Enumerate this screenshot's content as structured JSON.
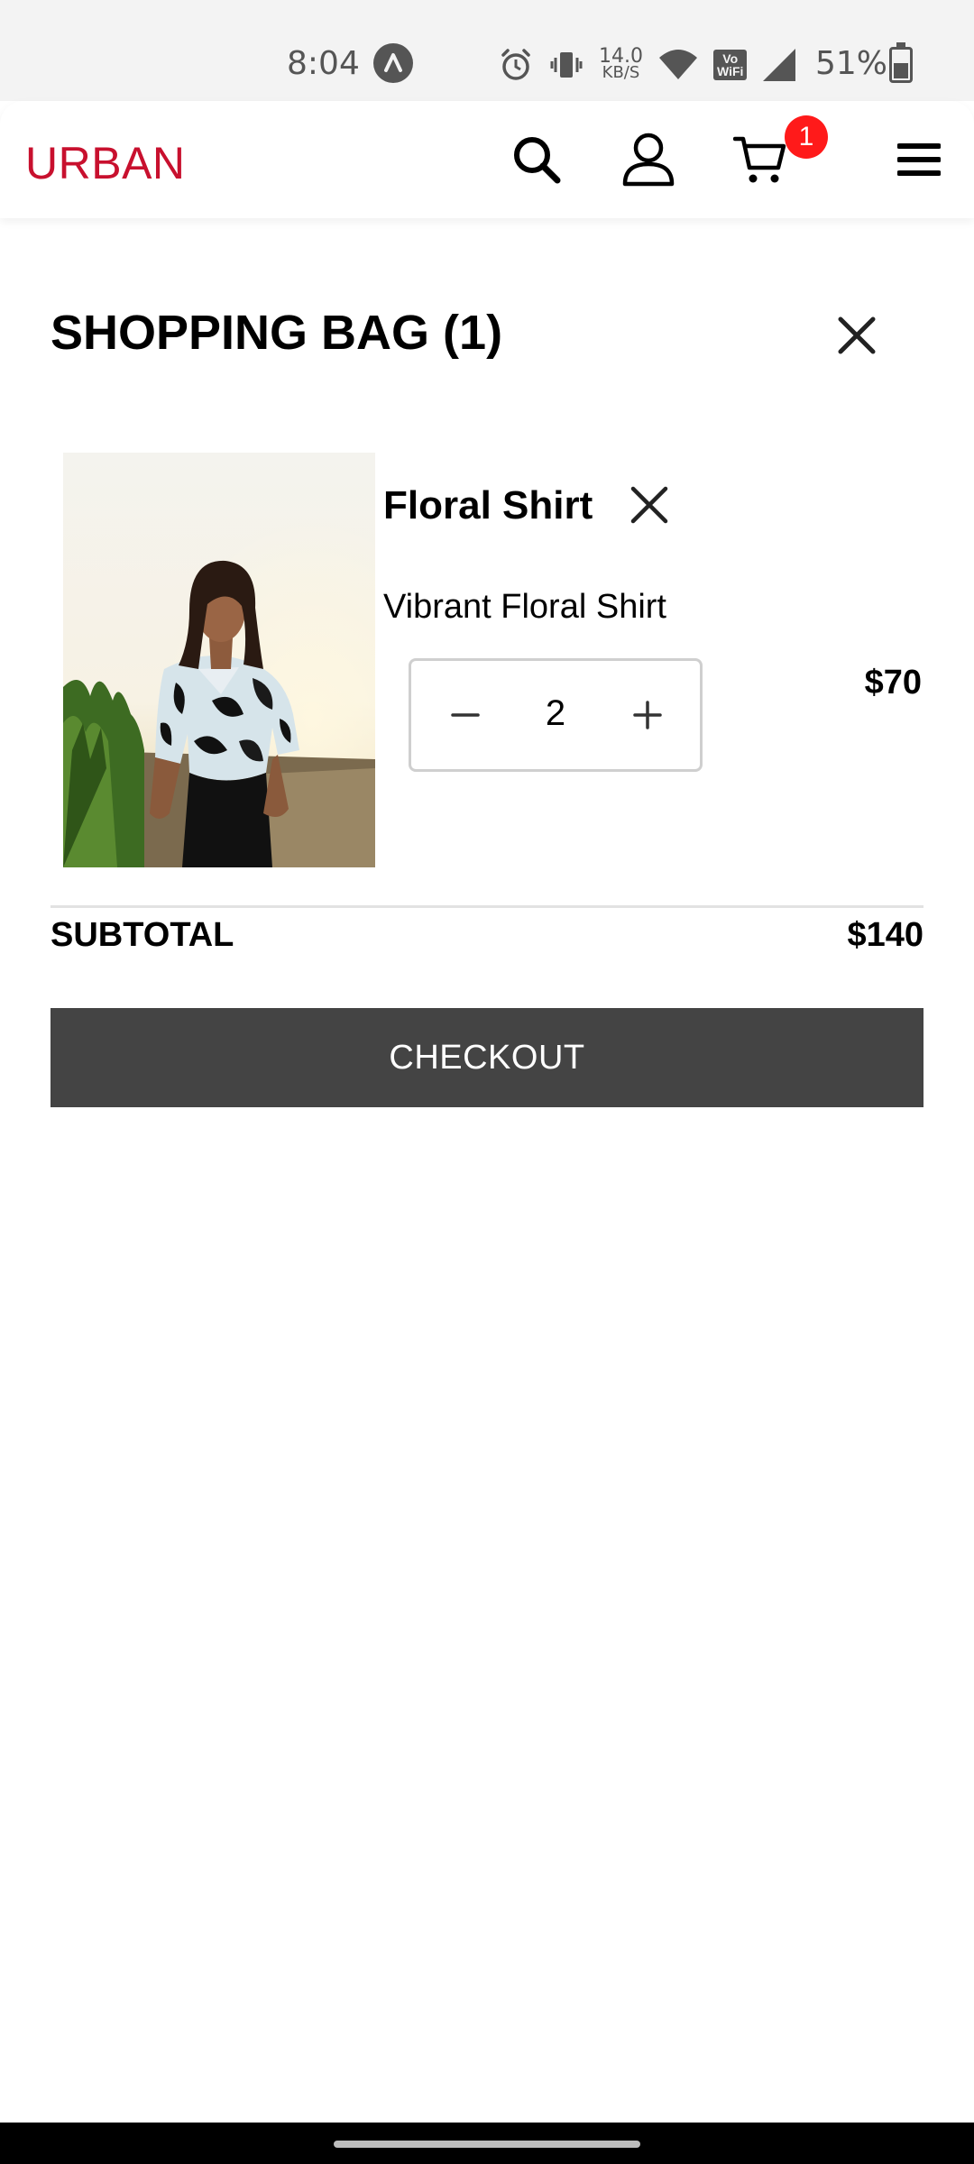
{
  "status_bar": {
    "time": "8:04",
    "network_speed_value": "14.0",
    "network_speed_unit": "KB/S",
    "volte_top": "Vo",
    "volte_bottom": "WiFi",
    "battery_percent": "51%",
    "battery_level": 0.51
  },
  "header": {
    "logo": "URBAN",
    "cart_count": "1",
    "icons": [
      "search-icon",
      "user-icon",
      "cart-icon",
      "menu-icon"
    ],
    "logo_color": "#c8102e",
    "badge_color": "#ff1a1a"
  },
  "bag": {
    "title": "SHOPPING BAG (1)",
    "items": [
      {
        "name": "Floral Shirt",
        "description": "Vibrant Floral Shirt",
        "quantity": "2",
        "price": "$70"
      }
    ],
    "subtotal_label": "SUBTOTAL",
    "subtotal_value": "$140",
    "checkout_label": "CHECKOUT",
    "checkout_color": "#444444"
  }
}
